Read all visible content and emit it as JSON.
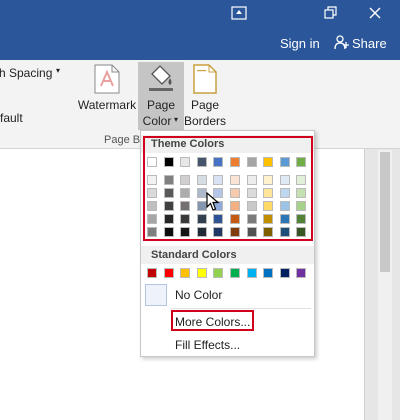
{
  "titlebar": {
    "sign_in": "Sign in",
    "share": "Share"
  },
  "ribbon": {
    "spacing_label": "h Spacing",
    "default_label": "fault",
    "watermark_label": "Watermark",
    "page_color_line1": "Page",
    "page_color_line2": "Color",
    "page_borders_line1": "Page",
    "page_borders_line2": "Borders",
    "group_label": "Page B"
  },
  "dropdown": {
    "theme_colors_title": "Theme Colors",
    "standard_colors_title": "Standard Colors",
    "no_color": "No Color",
    "more_colors": "More Colors...",
    "fill_effects": "Fill Effects..."
  },
  "theme_colors": {
    "top_row": [
      "#ffffff",
      "#000000",
      "#e7e6e6",
      "#44546a",
      "#4472c4",
      "#ed7d31",
      "#a5a5a5",
      "#ffc000",
      "#5b9bd5",
      "#70ad47"
    ],
    "shades": [
      [
        "#f2f2f2",
        "#808080",
        "#d0cece",
        "#d6dce4",
        "#d9e2f3",
        "#fbe4d5",
        "#ededed",
        "#fff2cc",
        "#deebf6",
        "#e2efd9"
      ],
      [
        "#d9d9d9",
        "#595959",
        "#aeabab",
        "#adb9ca",
        "#b4c6e7",
        "#f7caac",
        "#dbdbdb",
        "#ffe599",
        "#bdd7ee",
        "#c5e0b3"
      ],
      [
        "#bfbfbf",
        "#404040",
        "#757070",
        "#8496b0",
        "#8eaadb",
        "#f4b083",
        "#c9c9c9",
        "#ffd965",
        "#9cc3e5",
        "#a8d08d"
      ],
      [
        "#a6a6a6",
        "#262626",
        "#3a3838",
        "#323f4f",
        "#2f5496",
        "#c55a11",
        "#7b7b7b",
        "#bf8f00",
        "#2e75b5",
        "#538135"
      ],
      [
        "#7f7f7f",
        "#0d0d0d",
        "#161616",
        "#222a35",
        "#1f3864",
        "#833c0b",
        "#525252",
        "#7f6000",
        "#1f4e79",
        "#375623"
      ]
    ]
  },
  "standard_colors": [
    "#c00000",
    "#ff0000",
    "#ffc000",
    "#ffff00",
    "#92d050",
    "#00b050",
    "#00b0f0",
    "#0070c0",
    "#002060",
    "#7030a0"
  ],
  "accent": {
    "title_bar": "#2b579a",
    "highlight_box": "#d0021b"
  }
}
